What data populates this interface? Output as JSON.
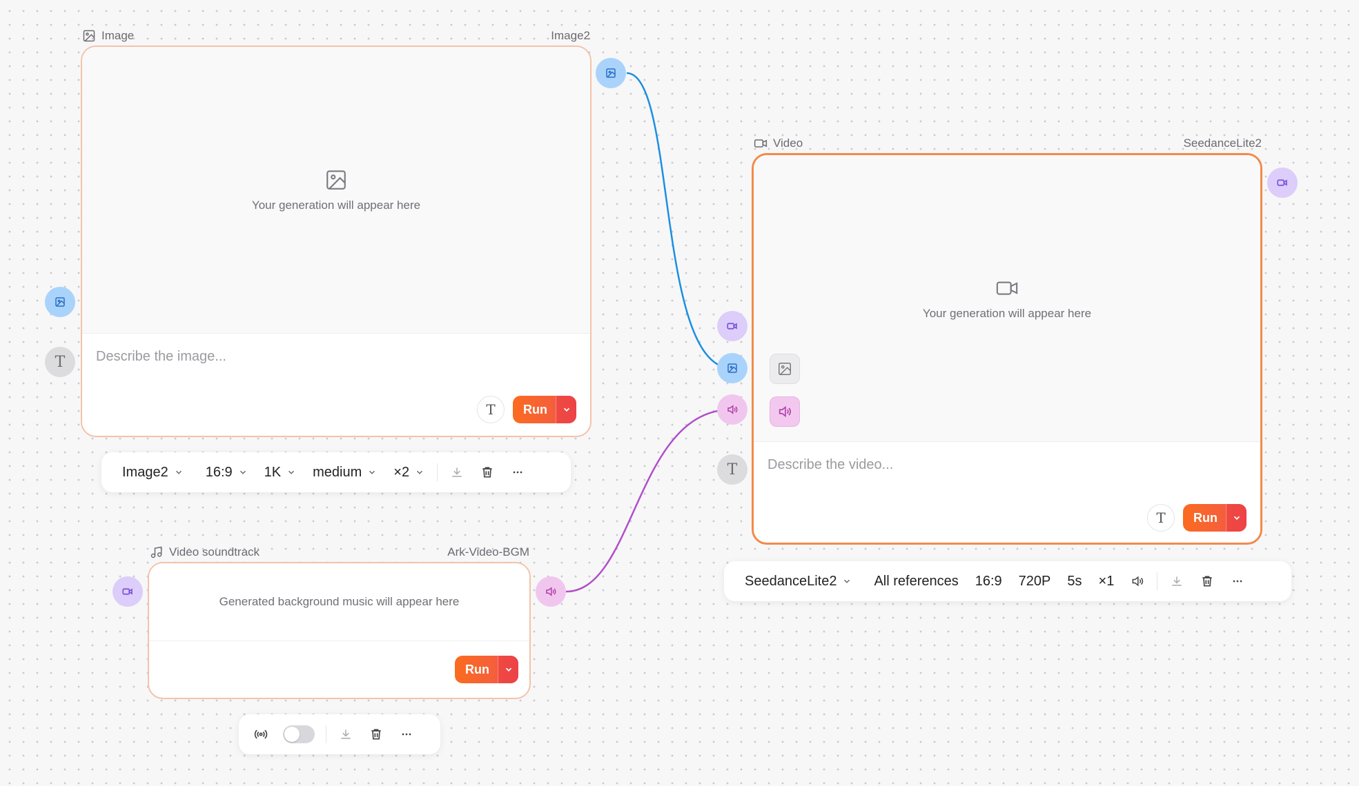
{
  "image_node": {
    "header_left": "Image",
    "header_right": "Image2",
    "placeholder": "Your generation will appear here",
    "prompt_placeholder": "Describe the image...",
    "run_label": "Run",
    "text_tool": "T"
  },
  "image_toolbar": {
    "model": "Image2",
    "aspect": "16:9",
    "resolution": "1K",
    "quality": "medium",
    "count": "×2"
  },
  "video_node": {
    "header_left": "Video",
    "header_right": "SeedanceLite2",
    "placeholder": "Your generation will appear here",
    "prompt_placeholder": "Describe the video...",
    "run_label": "Run",
    "text_tool": "T"
  },
  "video_toolbar": {
    "model": "SeedanceLite2",
    "references": "All references",
    "aspect": "16:9",
    "resolution": "720P",
    "duration": "5s",
    "count": "×1"
  },
  "soundtrack_node": {
    "header_left": "Video soundtrack",
    "header_right": "Ark-Video-BGM",
    "placeholder": "Generated background music will appear here",
    "run_label": "Run"
  },
  "soundtrack_toolbar": {
    "toggle_on": false
  },
  "handles": {
    "text_glyph": "T"
  },
  "colors": {
    "image_edge": "#1a8fe0",
    "audio_edge": "#b04ec9",
    "accent_orange": "#fb6b20",
    "active_border": "#f28a4a"
  }
}
